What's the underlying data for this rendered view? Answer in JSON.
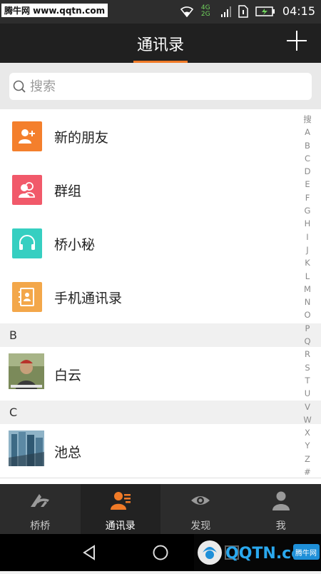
{
  "status_bar": {
    "watermark": "腾牛网 www.qqtn.com",
    "network": "4G 2G",
    "time": "04:15"
  },
  "header": {
    "title": "通讯录",
    "add_icon": "plus-icon"
  },
  "search": {
    "placeholder": "搜索"
  },
  "fixed_items": [
    {
      "label": "新的朋友",
      "icon": "add-friend-icon",
      "color": "#f47f2c"
    },
    {
      "label": "群组",
      "icon": "group-icon",
      "color": "#f1596a"
    },
    {
      "label": "桥小秘",
      "icon": "headset-icon",
      "color": "#36cfc1"
    },
    {
      "label": "手机通讯录",
      "icon": "phonebook-icon",
      "color": "#f3a74a"
    }
  ],
  "sections": [
    {
      "letter": "B",
      "contacts": [
        {
          "name": "白云"
        }
      ]
    },
    {
      "letter": "C",
      "contacts": [
        {
          "name": "池总"
        }
      ]
    }
  ],
  "index_letters": [
    "搜",
    "A",
    "B",
    "C",
    "D",
    "E",
    "F",
    "G",
    "H",
    "I",
    "J",
    "K",
    "L",
    "M",
    "N",
    "O",
    "P",
    "Q",
    "R",
    "S",
    "T",
    "U",
    "V",
    "W",
    "X",
    "Y",
    "Z",
    "#"
  ],
  "tabs": [
    {
      "label": "桥桥",
      "icon": "bridge-icon",
      "active": false
    },
    {
      "label": "通讯录",
      "icon": "contacts-icon",
      "active": true
    },
    {
      "label": "发现",
      "icon": "discover-icon",
      "active": false
    },
    {
      "label": "我",
      "icon": "me-icon",
      "active": false
    }
  ],
  "bottom_watermark": {
    "text": "QQTN.com",
    "badge": "腾牛网"
  },
  "colors": {
    "accent": "#f07a27",
    "header_bg": "#202020",
    "tab_bg": "#2c2c2c"
  }
}
